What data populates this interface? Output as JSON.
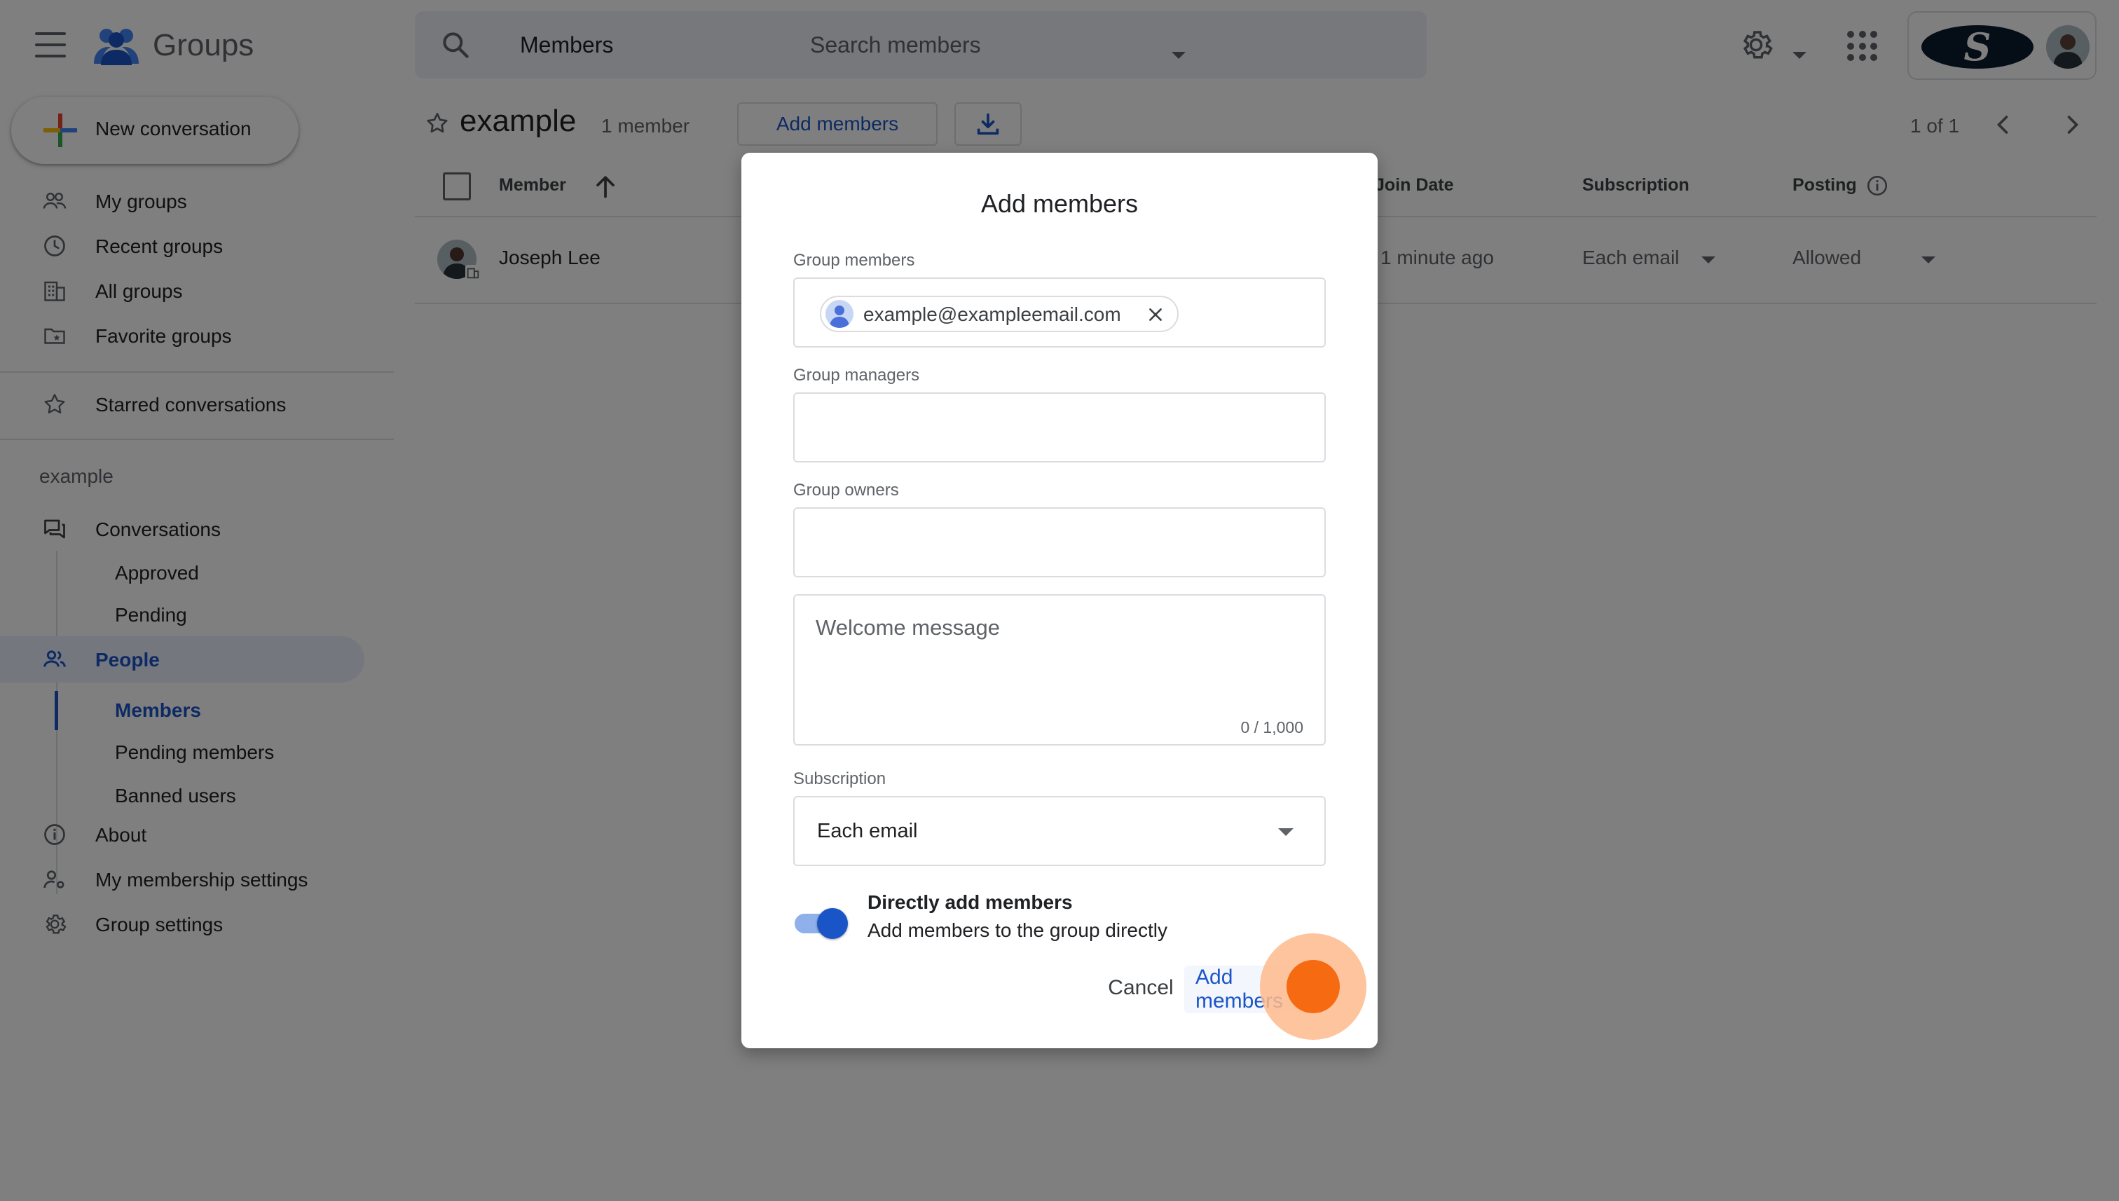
{
  "app": {
    "name": "Groups"
  },
  "search": {
    "scope": "Members",
    "placeholder": "Search members"
  },
  "account": {
    "logo_letter": "S"
  },
  "sidebar": {
    "new_conversation": "New conversation",
    "top_items": [
      {
        "label": "My groups",
        "icon": "people-icon"
      },
      {
        "label": "Recent groups",
        "icon": "clock-icon"
      },
      {
        "label": "All groups",
        "icon": "building-icon"
      },
      {
        "label": "Favorite groups",
        "icon": "folder-star-icon"
      }
    ],
    "starred": "Starred conversations",
    "group_section": "example",
    "conversations": "Conversations",
    "conversation_subitems": [
      "Approved",
      "Pending"
    ],
    "people": "People",
    "people_subitems": [
      "Members",
      "Pending members",
      "Banned users"
    ],
    "bottom_items": [
      {
        "label": "About",
        "icon": "info-icon"
      },
      {
        "label": "My membership settings",
        "icon": "person-gear-icon"
      },
      {
        "label": "Group settings",
        "icon": "gear-icon"
      }
    ]
  },
  "main": {
    "group_title": "example",
    "member_count": "1 member",
    "add_members_label": "Add members",
    "pagination": "1 of 1",
    "columns": {
      "member": "Member",
      "join_date": "Join Date",
      "subscription": "Subscription",
      "posting": "Posting"
    },
    "rows": [
      {
        "name": "Joseph Lee",
        "join_date": "1 minute ago",
        "subscription": "Each email",
        "posting": "Allowed"
      }
    ]
  },
  "dialog": {
    "title": "Add members",
    "group_members_label": "Group members",
    "member_chip": "example@exampleemail.com",
    "group_managers_label": "Group managers",
    "group_owners_label": "Group owners",
    "welcome_placeholder": "Welcome message",
    "char_count": "0 / 1,000",
    "subscription_label": "Subscription",
    "subscription_value": "Each email",
    "toggle_title": "Directly add members",
    "toggle_desc": "Add members to the group directly",
    "toggle_on": true,
    "cancel_label": "Cancel",
    "confirm_label": "Add members"
  },
  "colors": {
    "accent": "#1a55c8",
    "click_indicator": "#f66a12"
  }
}
